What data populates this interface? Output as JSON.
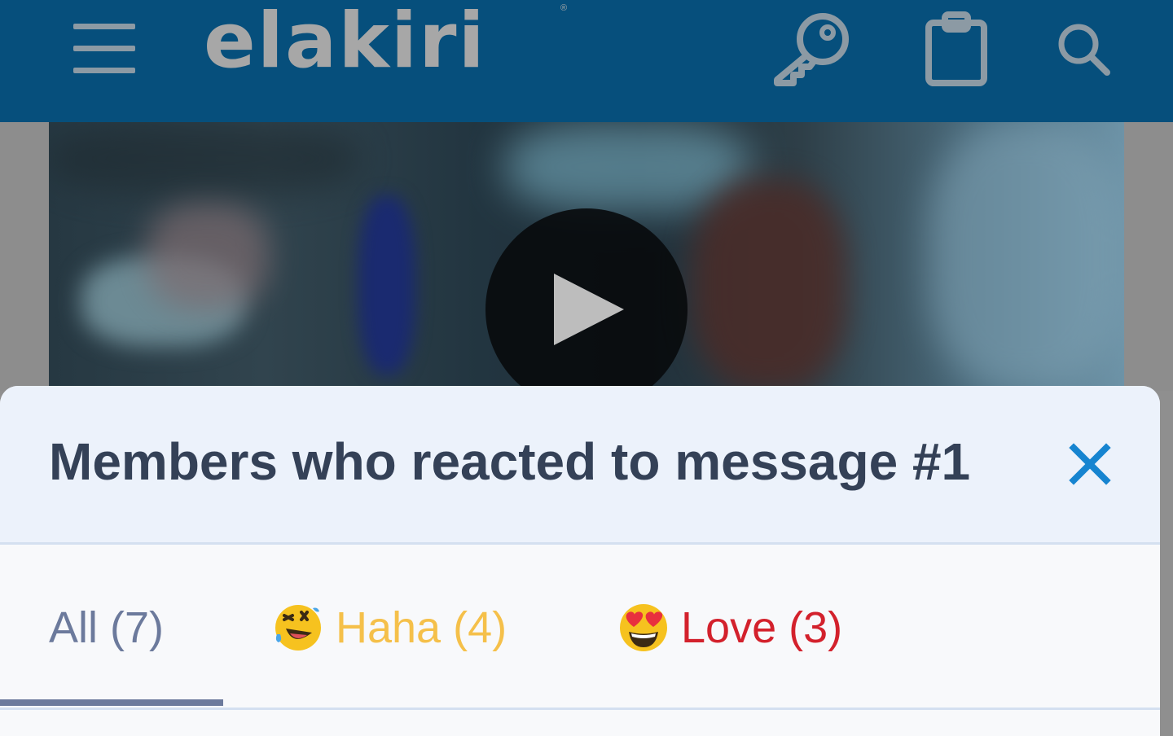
{
  "header": {
    "logo_text": "elakiri",
    "logo_mark": "®",
    "icons": [
      "menu-icon",
      "key-icon",
      "clipboard-icon",
      "search-icon"
    ],
    "background_color": "#064f7c"
  },
  "video": {
    "icon": "play-icon"
  },
  "reactions_dialog": {
    "title": "Members who reacted to message #1",
    "close_icon": "close-icon",
    "tabs": [
      {
        "label": "All (7)",
        "emoji": "",
        "color": "#6c7a9c",
        "active": true
      },
      {
        "label": "Haha (4)",
        "emoji": "rolling-laughing-icon",
        "color": "#f5c04a",
        "active": false
      },
      {
        "label": "Love (3)",
        "emoji": "heart-eyes-icon",
        "color": "#d3212c",
        "active": false
      }
    ]
  }
}
